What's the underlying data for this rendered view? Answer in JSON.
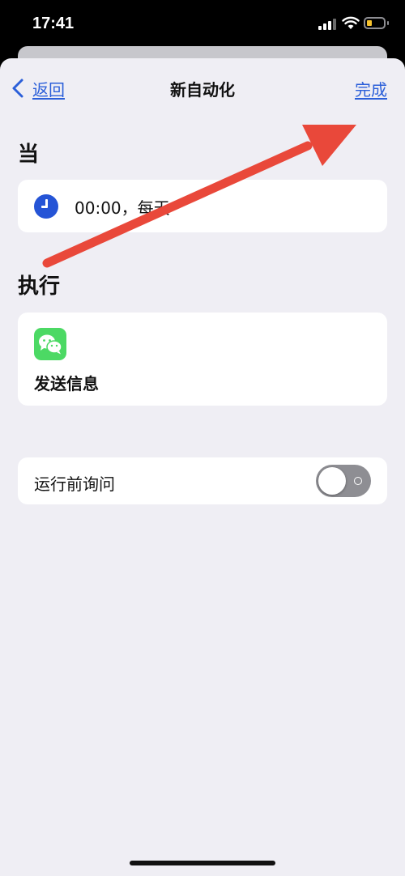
{
  "status_bar": {
    "time": "17:41"
  },
  "nav": {
    "back_label": "返回",
    "title": "新自动化",
    "done_label": "完成"
  },
  "when": {
    "section_title": "当",
    "trigger_text": "00:00，每天",
    "icon": "clock-icon"
  },
  "do": {
    "section_title": "执行",
    "action_label": "发送信息",
    "icon": "wechat-icon"
  },
  "ask_before_running": {
    "label": "运行前询问",
    "enabled": false
  },
  "colors": {
    "accent": "#2b5fd9",
    "background": "#efeef4",
    "clock": "#2554d6",
    "wechat": "#4cd964",
    "annotation_arrow": "#e9483a"
  }
}
